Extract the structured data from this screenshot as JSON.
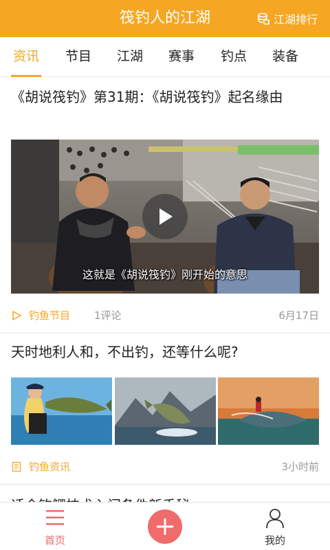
{
  "header": {
    "title": "筏钓人的江湖",
    "rank_label": "江湖排行",
    "accent_color": "#f5a623"
  },
  "tabs": [
    {
      "label": "资讯",
      "active": true
    },
    {
      "label": "节目",
      "active": false
    },
    {
      "label": "江湖",
      "active": false
    },
    {
      "label": "赛事",
      "active": false
    },
    {
      "label": "钓点",
      "active": false
    },
    {
      "label": "装备",
      "active": false
    }
  ],
  "feed": {
    "items": [
      {
        "title": "《胡说筏钓》第31期：《胡说筏钓》起名缘由",
        "video_subtitle": "这就是《胡说筏钓》刚开始的意思",
        "tag_icon": "play-outline-icon",
        "tag": "钓鱼节目",
        "comments": "1评论",
        "time": "6月17日"
      },
      {
        "title": "天时地利人和，不出钓，还等什么呢?",
        "tag_icon": "article-icon",
        "tag": "钓鱼资讯",
        "time": "3小时前"
      },
      {
        "title": "适合钓鲫技术入门条件新手秘"
      }
    ]
  },
  "bottom_nav": {
    "home_label": "首页",
    "add_icon": "plus-icon",
    "me_label": "我的",
    "home_color": "#e86a6a",
    "add_color": "#f06b6b"
  }
}
